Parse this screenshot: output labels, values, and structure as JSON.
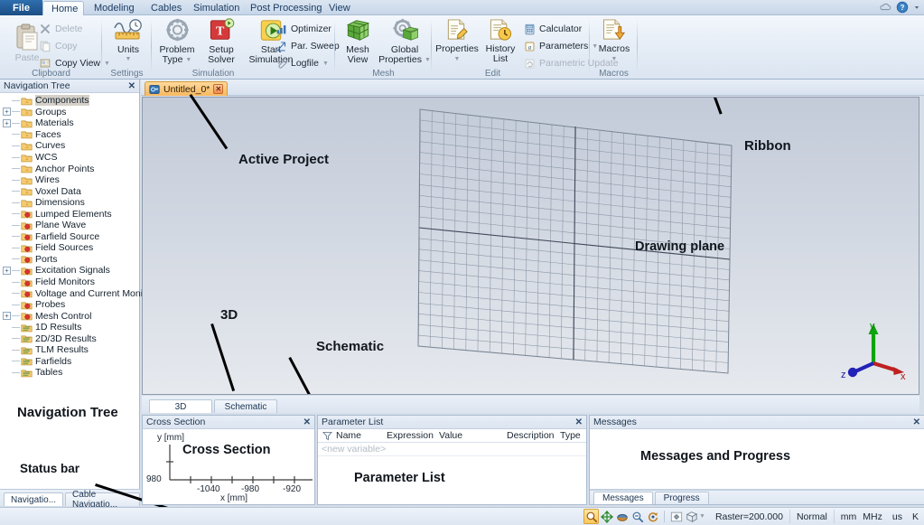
{
  "window": {
    "title": "CST Studio Suite"
  },
  "ribbon": {
    "file_label": "File",
    "tabs": [
      {
        "label": "Home",
        "active": true
      },
      {
        "label": "Modeling",
        "active": false
      },
      {
        "label": "Cables",
        "active": false
      },
      {
        "label": "Simulation",
        "active": false
      },
      {
        "label": "Post Processing",
        "active": false
      },
      {
        "label": "View",
        "active": false
      }
    ],
    "help_icons": [
      "cloud-icon",
      "help-icon",
      "chevron-down-icon"
    ],
    "groups": [
      {
        "title": "Clipboard",
        "big": [
          {
            "label_1": "Paste",
            "label_2": "",
            "icon": "paste-icon",
            "disabled": true
          }
        ],
        "small": [
          {
            "label": "Delete",
            "icon": "delete-x-icon",
            "disabled": true,
            "caret": false
          },
          {
            "label": "Copy",
            "icon": "copy-icon",
            "disabled": true,
            "caret": false
          },
          {
            "label": "Copy View",
            "icon": "copy-view-icon",
            "disabled": false,
            "caret": true
          }
        ]
      },
      {
        "title": "Settings",
        "big": [
          {
            "label_1": "Units",
            "label_2": "",
            "icon": "units-icon",
            "caret": true
          }
        ],
        "small": []
      },
      {
        "title": "Simulation",
        "big": [
          {
            "label_1": "Problem",
            "label_2": "Type",
            "icon": "problem-type-icon",
            "caret_inline": true
          },
          {
            "label_1": "Setup",
            "label_2": "Solver",
            "icon": "setup-solver-icon"
          },
          {
            "label_1": "Start",
            "label_2": "Simulation",
            "icon": "start-simulation-icon"
          }
        ],
        "small": [
          {
            "label": "Optimizer",
            "icon": "optimizer-icon",
            "disabled": false,
            "caret": false
          },
          {
            "label": "Par. Sweep",
            "icon": "par-sweep-icon",
            "disabled": false,
            "caret": false
          },
          {
            "label": "Logfile",
            "icon": "logfile-icon",
            "disabled": false,
            "caret": true
          }
        ]
      },
      {
        "title": "Mesh",
        "big": [
          {
            "label_1": "Mesh",
            "label_2": "View",
            "icon": "mesh-view-icon"
          },
          {
            "label_1": "Global",
            "label_2": "Properties",
            "icon": "global-properties-icon",
            "caret_inline": true
          }
        ],
        "small": []
      },
      {
        "title": "Edit",
        "big": [
          {
            "label_1": "Properties",
            "label_2": "",
            "icon": "properties-icon",
            "caret": true
          },
          {
            "label_1": "History",
            "label_2": "List",
            "icon": "history-list-icon"
          }
        ],
        "small": [
          {
            "label": "Calculator",
            "icon": "calculator-icon",
            "disabled": false,
            "caret": false
          },
          {
            "label": "Parameters",
            "icon": "parameters-icon",
            "disabled": false,
            "caret": true
          },
          {
            "label": "Parametric Update",
            "icon": "parametric-update-icon",
            "disabled": true,
            "caret": false
          }
        ]
      },
      {
        "title": "Macros",
        "big": [
          {
            "label_1": "Macros",
            "label_2": "",
            "icon": "macros-icon",
            "caret": true
          }
        ],
        "small": []
      }
    ]
  },
  "navigation_tree": {
    "header": "Navigation Tree",
    "close_icon": "close-icon",
    "items": [
      {
        "label": "Components",
        "expand": "",
        "icon": "folder-icon",
        "selected": true
      },
      {
        "label": "Groups",
        "expand": "+",
        "icon": "folder-icon",
        "selected": false
      },
      {
        "label": "Materials",
        "expand": "+",
        "icon": "folder-icon",
        "selected": false
      },
      {
        "label": "Faces",
        "expand": "",
        "icon": "folder-icon",
        "selected": false
      },
      {
        "label": "Curves",
        "expand": "",
        "icon": "folder-icon",
        "selected": false
      },
      {
        "label": "WCS",
        "expand": "",
        "icon": "folder-icon",
        "selected": false
      },
      {
        "label": "Anchor Points",
        "expand": "",
        "icon": "folder-icon",
        "selected": false
      },
      {
        "label": "Wires",
        "expand": "",
        "icon": "folder-icon",
        "selected": false
      },
      {
        "label": "Voxel Data",
        "expand": "",
        "icon": "folder-icon",
        "selected": false
      },
      {
        "label": "Dimensions",
        "expand": "",
        "icon": "folder-icon",
        "selected": false
      },
      {
        "label": "Lumped Elements",
        "expand": "",
        "icon": "red-gear-folder-icon",
        "selected": false
      },
      {
        "label": "Plane Wave",
        "expand": "",
        "icon": "red-gear-folder-icon",
        "selected": false
      },
      {
        "label": "Farfield Source",
        "expand": "",
        "icon": "red-gear-folder-icon",
        "selected": false
      },
      {
        "label": "Field Sources",
        "expand": "",
        "icon": "red-gear-folder-icon",
        "selected": false
      },
      {
        "label": "Ports",
        "expand": "",
        "icon": "red-gear-folder-icon",
        "selected": false
      },
      {
        "label": "Excitation Signals",
        "expand": "+",
        "icon": "red-gear-folder-icon",
        "selected": false
      },
      {
        "label": "Field Monitors",
        "expand": "",
        "icon": "red-gear-folder-icon",
        "selected": false
      },
      {
        "label": "Voltage and Current Monitors",
        "expand": "",
        "icon": "red-gear-folder-icon",
        "selected": false
      },
      {
        "label": "Probes",
        "expand": "",
        "icon": "red-gear-folder-icon",
        "selected": false
      },
      {
        "label": "Mesh Control",
        "expand": "+",
        "icon": "red-gear-folder-icon",
        "selected": false
      },
      {
        "label": "1D Results",
        "expand": "",
        "icon": "results-folder-icon",
        "selected": false
      },
      {
        "label": "2D/3D Results",
        "expand": "",
        "icon": "results-folder-icon",
        "selected": false
      },
      {
        "label": "TLM Results",
        "expand": "",
        "icon": "results-folder-icon",
        "selected": false
      },
      {
        "label": "Farfields",
        "expand": "",
        "icon": "results-folder-icon",
        "selected": false
      },
      {
        "label": "Tables",
        "expand": "",
        "icon": "results-folder-icon",
        "selected": false
      }
    ],
    "tabs": [
      {
        "label": "Navigatio...",
        "active": true
      },
      {
        "label": "Cable Navigatio...",
        "active": false
      }
    ]
  },
  "annotations": [
    {
      "id": "active-project",
      "text": "Active Project"
    },
    {
      "id": "ribbon",
      "text": "Ribbon"
    },
    {
      "id": "drawing-plane",
      "text": "Drawing plane"
    },
    {
      "id": "three-d",
      "text": "3D"
    },
    {
      "id": "schematic",
      "text": "Schematic"
    },
    {
      "id": "navigation-tree",
      "text": "Navigation Tree"
    },
    {
      "id": "status-bar",
      "text": "Status bar"
    }
  ],
  "document": {
    "tab_title": "Untitled_0*",
    "tab_icon": "project-icon",
    "close_icon": "close-icon",
    "view_tabs": [
      {
        "label": "3D",
        "active": true
      },
      {
        "label": "Schematic",
        "active": false
      }
    ],
    "axes": {
      "x": "x",
      "y": "y",
      "z": "z"
    }
  },
  "cross_section": {
    "header": "Cross Section",
    "close_icon": "close-icon",
    "body_label": "Cross Section",
    "ylabel": "y [mm]",
    "xlabel": "x [mm]",
    "ytick": "980",
    "xticks": [
      "-1040",
      "-980",
      "-920"
    ]
  },
  "parameter_list": {
    "header": "Parameter List",
    "close_icon": "close-icon",
    "body_label": "Parameter List",
    "filter_icon": "filter-icon",
    "columns": [
      "Name",
      "Expression",
      "Value",
      "Description",
      "Type"
    ],
    "new_row_placeholder": "<new variable>",
    "rows": []
  },
  "messages": {
    "header": "Messages",
    "close_icon": "close-icon",
    "body_label": "Messages and Progress",
    "tabs": [
      {
        "label": "Messages",
        "active": true
      },
      {
        "label": "Progress",
        "active": false
      }
    ]
  },
  "status_bar": {
    "icons": [
      {
        "name": "zoom-select-icon",
        "active": true
      },
      {
        "name": "pan-move-icon",
        "active": false
      },
      {
        "name": "rotate-icon",
        "active": false
      },
      {
        "name": "zoom-out-icon",
        "active": false
      },
      {
        "name": "rotate-view-icon",
        "active": false
      },
      {
        "name": "fit-to-screen-icon",
        "active": false
      },
      {
        "name": "view-cube-icon",
        "active": false,
        "caret": true
      }
    ],
    "fields": [
      {
        "name": "raster",
        "text": "Raster=200.000"
      },
      {
        "name": "snap-mode",
        "text": "Normal"
      },
      {
        "name": "length-unit",
        "text": "mm"
      },
      {
        "name": "frequency-unit",
        "text": "MHz"
      },
      {
        "name": "time-unit",
        "text": "us"
      },
      {
        "name": "temperature-unit",
        "text": "K"
      }
    ]
  },
  "colors": {
    "accent_blue": "#1c4e84",
    "tab_orange": "#f6b860",
    "viewport_bg": "#d2d8e2",
    "grid_line": "#8f99a8",
    "axis_x": "#c02020",
    "axis_y": "#10a010",
    "axis_z": "#2020c0"
  }
}
